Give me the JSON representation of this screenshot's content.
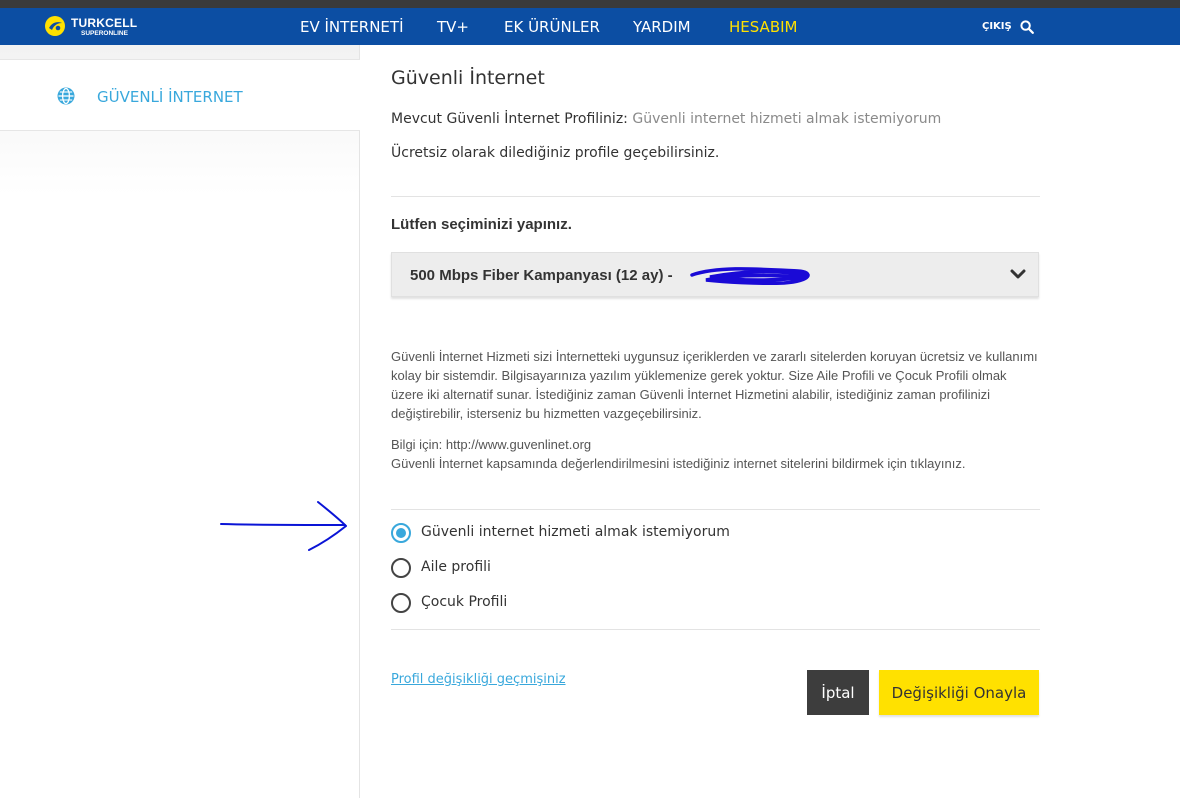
{
  "nav": {
    "brand": "TURKCELL",
    "brand_sub": "SUPERONLINE",
    "items": [
      {
        "label": "EV İNTERNETİ"
      },
      {
        "label": "TV+"
      },
      {
        "label": "EK ÜRÜNLER"
      },
      {
        "label": "YARDIM"
      },
      {
        "label": "HESABIM",
        "active": true
      }
    ],
    "logout": "ÇIKIŞ"
  },
  "sidebar": {
    "items": [
      {
        "label": "GÜVENLİ İNTERNET",
        "icon": "globe-icon"
      }
    ]
  },
  "main": {
    "title": "Güvenli İnternet",
    "current_profile_label": "Mevcut Güvenli İnternet Profiliniz:",
    "current_profile_value": "Güvenli internet hizmeti almak istemiyorum",
    "free_note": "Ücretsiz olarak dilediğiniz profile geçebilirsiniz.",
    "select_label": "Lütfen seçiminizi yapınız.",
    "selected_plan": "500 Mbps Fiber Kampanyası (12 ay) -",
    "description": "Güvenli İnternet Hizmeti sizi İnternetteki uygunsuz içeriklerden ve zararlı sitelerden koruyan ücretsiz ve kullanımı kolay bir sistemdir. Bilgisayarınıza yazılım yüklemenize gerek yoktur. Size Aile Profili ve Çocuk Profili olmak üzere iki alternatif sunar. İstediğiniz zaman Güvenli İnternet Hizmetini alabilir, istediğiniz zaman profilinizi değiştirebilir, isterseniz bu hizmetten vazgeçebilirsiniz.",
    "info_line": "Bilgi için: http://www.guvenlinet.org",
    "report_line": "Güvenli İnternet kapsamında değerlendirilmesini istediğiniz internet sitelerini bildirmek için tıklayınız.",
    "options": [
      {
        "label": "Güvenli internet hizmeti almak istemiyorum",
        "checked": true
      },
      {
        "label": "Aile profili",
        "checked": false
      },
      {
        "label": "Çocuk Profili",
        "checked": false
      }
    ],
    "history_link": "Profil değişikliği geçmişiniz",
    "cancel_label": "İptal",
    "confirm_label": "Değişikliği Onayla"
  },
  "colors": {
    "nav_bg": "#0c4ea3",
    "accent": "#39a8dc",
    "active_nav": "#ffe100",
    "confirm_bg": "#ffe100",
    "cancel_bg": "#3d3d3d",
    "annotation": "#0a14d6"
  }
}
